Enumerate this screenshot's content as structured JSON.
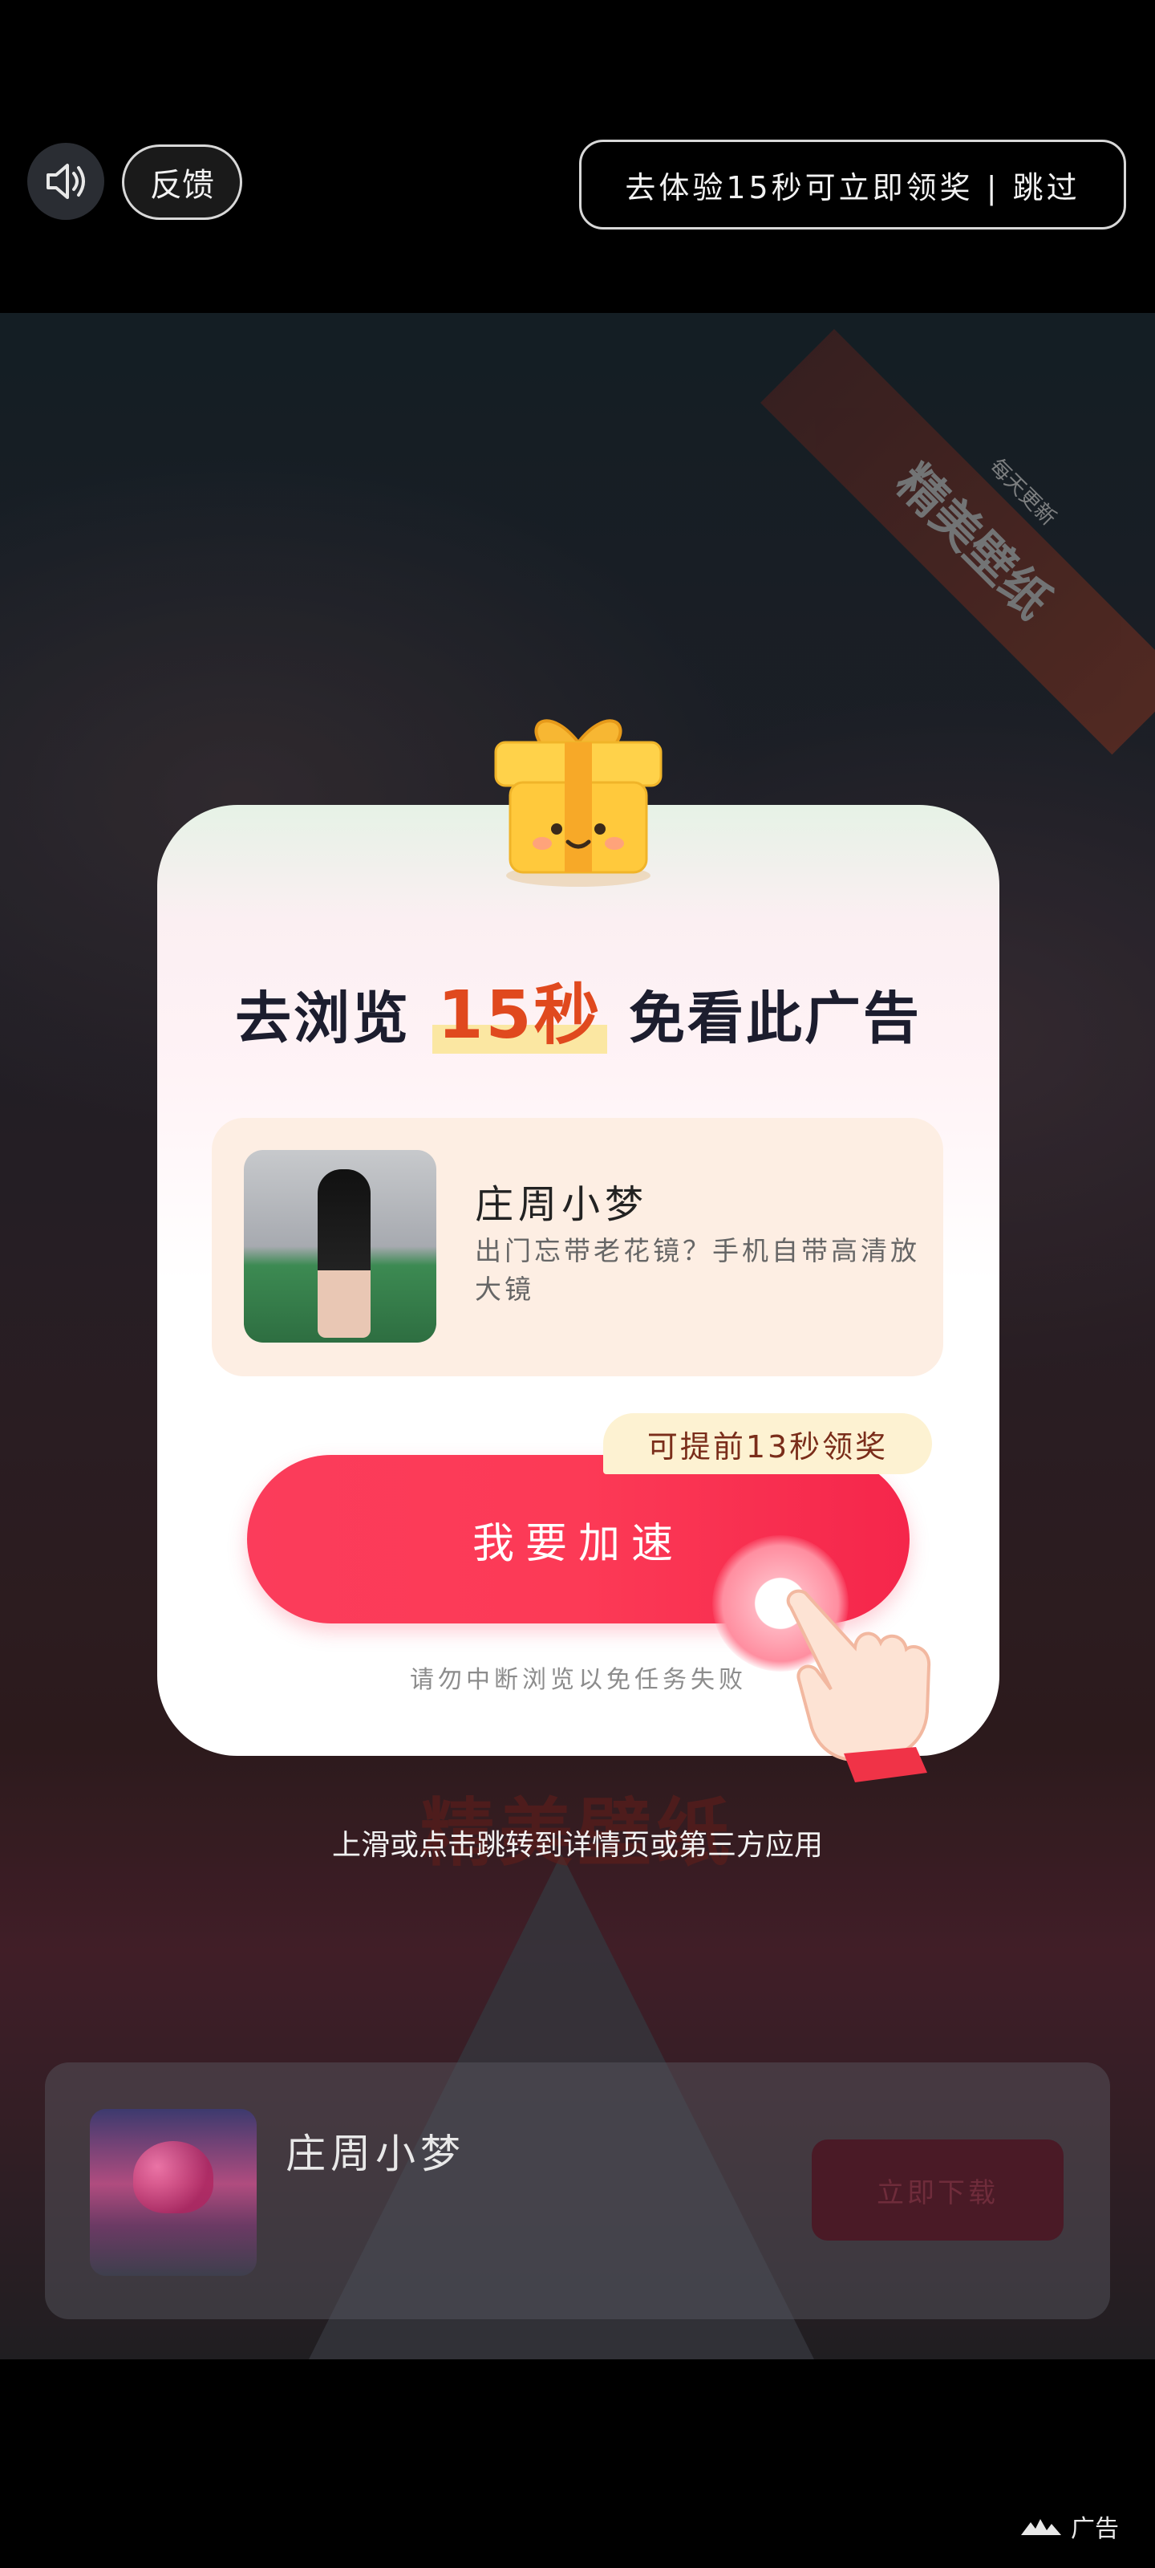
{
  "topbar": {
    "sound_icon": "speaker-icon",
    "feedback_label": "反馈",
    "skip_label": "去体验15秒可立即领奖 | 跳过"
  },
  "background": {
    "ribbon_small": "每天更新",
    "ribbon_text": "精美壁纸",
    "watermark": "精美壁纸"
  },
  "modal": {
    "title_prefix": "去浏览",
    "title_highlight": "15秒",
    "title_suffix": "免看此广告",
    "gift_icon": "gift-box-icon",
    "task": {
      "title": "庄周小梦",
      "description": "出门忘带老花镜？手机自带高清放大镜"
    },
    "speed_badge": "可提前13秒领奖",
    "speed_button": "我要加速",
    "hand_icon": "pointing-hand-icon",
    "warning": "请勿中断浏览以免任务失败"
  },
  "swipe_hint": "上滑或点击跳转到详情页或第三方应用",
  "app_card": {
    "name": "庄周小梦",
    "download_label": "立即下载"
  },
  "ad_tag": {
    "label": "广告",
    "icon": "ad-logo-icon"
  },
  "colors": {
    "accent": "#fc3a56",
    "highlight": "#e0491e",
    "badge_bg": "#fdf2d2"
  }
}
